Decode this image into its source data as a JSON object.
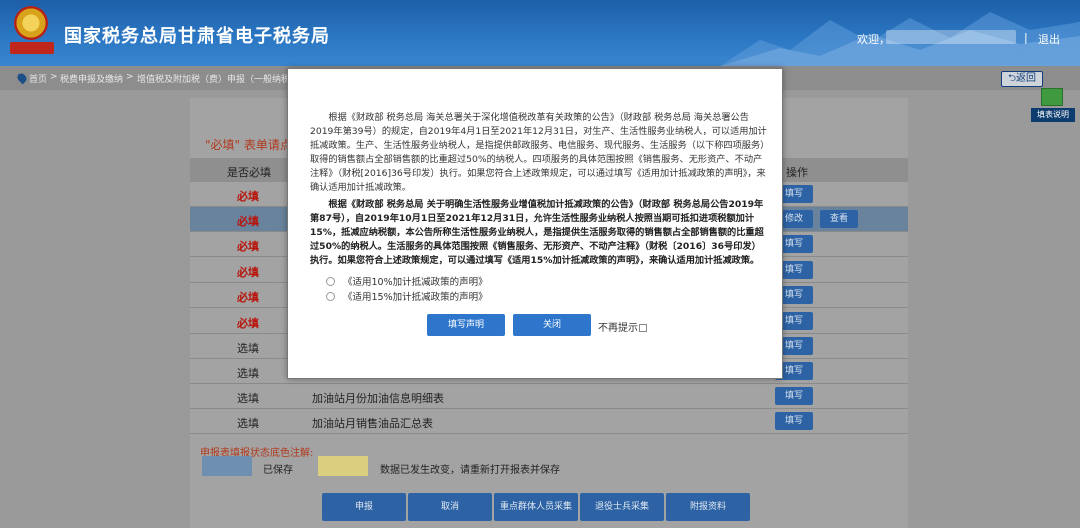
{
  "header": {
    "title": "国家税务总局甘肃省电子税务局",
    "emblem_text": "中国税务",
    "welcome": "欢迎，",
    "separator": "|",
    "logout": "退出"
  },
  "breadcrumb": {
    "home": "首页",
    "level1": "税费申报及缴纳",
    "level2": "增值税及附加税（费）申报（一般纳税人"
  },
  "actions": {
    "back": "返回",
    "fill_guide": "填表说明"
  },
  "background_table": {
    "notice": "\"必填\" 表单请点",
    "headers": {
      "required": "是否必填",
      "operation": "操作"
    },
    "rows": [
      {
        "required": "必填",
        "name": "",
        "buttons": [
          "填写"
        ]
      },
      {
        "required": "必填",
        "name": "",
        "buttons": [
          "修改",
          "查看"
        ],
        "selected": true
      },
      {
        "required": "必填",
        "name": "",
        "buttons": [
          "填写"
        ]
      },
      {
        "required": "必填",
        "name": "",
        "buttons": [
          "填写"
        ]
      },
      {
        "required": "必填",
        "name": "",
        "buttons": [
          "填写"
        ]
      },
      {
        "required": "必填",
        "name": "",
        "buttons": [
          "填写"
        ]
      },
      {
        "required": "选填",
        "name": "",
        "buttons": [
          "填写"
        ]
      },
      {
        "required": "选填",
        "name": "",
        "buttons": [
          "填写"
        ]
      },
      {
        "required": "选填",
        "name": "加油站月份加油信息明细表",
        "buttons": [
          "填写"
        ]
      },
      {
        "required": "选填",
        "name": "加油站月销售油品汇总表",
        "buttons": [
          "填写"
        ]
      }
    ],
    "legend_title": "申报表填报状态底色注解:",
    "legend_saved": "已保存",
    "legend_changed": "数据已发生改变，请重新打开报表并保存",
    "saved_color": "#6f8fb0",
    "changed_color": "#d9cf7e"
  },
  "footer_buttons": {
    "submit": "申报",
    "cancel": "取消",
    "key_group": "重点群体人员采集",
    "veteran": "退役士兵采集",
    "attachments": "附报资料"
  },
  "modal": {
    "para1": "根据《财政部 税务总局 海关总署关于深化增值税改革有关政策的公告》（财政部 税务总局 海关总署公告2019年第39号）的规定，自2019年4月1日至2021年12月31日，对生产、生活性服务业纳税人，可以适用加计抵减政策。生产、生活性服务业纳税人，是指提供邮政服务、电信服务、现代服务、生活服务（以下称四项服务）取得的销售额占全部销售额的比重超过50%的纳税人。四项服务的具体范围按照《销售服务、无形资产、不动产注释》（财税[2016]36号印发）执行。如果您符合上述政策规定，可以通过填写《适用加计抵减政策的声明》，来确认适用加计抵减政策。",
    "para2": "根据《财政部 税务总局 关于明确生活性服务业增值税加计抵减政策的公告》（财政部 税务总局公告2019年第87号），自2019年10月1日至2021年12月31日，允许生活性服务业纳税人按照当期可抵扣进项税额加计15%，抵减应纳税额，本公告所称生活性服务业纳税人，是指提供生活服务取得的销售额占全部销售额的比重超过50%的纳税人。生活服务的具体范围按照《销售服务、无形资产、不动产注释》（财税〔2016〕36号印发）执行。如果您符合上述政策规定，可以通过填写《适用15%加计抵减政策的声明》，来确认适用加计抵减政策。",
    "option1": "《适用10%加计抵减政策的声明》",
    "option2": "《适用15%加计抵减政策的声明》",
    "fill_button": "填写声明",
    "close_button": "关闭",
    "dont_show": "不再提示"
  },
  "colors": {
    "header_blue": "#2c78c4",
    "button_blue": "#2d76cc",
    "required_red": "#b8140a"
  }
}
